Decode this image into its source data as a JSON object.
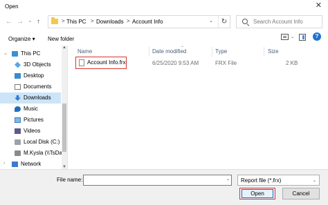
{
  "window": {
    "title": "Open",
    "close_glyph": "✕"
  },
  "nav": {
    "back_glyph": "←",
    "forward_glyph": "→",
    "dropdown_glyph": "⌄",
    "up_glyph": "↑",
    "breadcrumbs": [
      "This PC",
      "Downloads",
      "Account Info"
    ],
    "separator": ">",
    "refresh_glyph": "↻",
    "search_placeholder": "Search Account Info"
  },
  "toolbar": {
    "organize_label": "Organize ▾",
    "new_folder_label": "New folder",
    "help_glyph": "?"
  },
  "sidebar": {
    "items": [
      {
        "label": "This PC",
        "icon": "pc-icon"
      },
      {
        "label": "3D Objects",
        "icon": "3d-objects-icon"
      },
      {
        "label": "Desktop",
        "icon": "desktop-icon"
      },
      {
        "label": "Documents",
        "icon": "documents-icon"
      },
      {
        "label": "Downloads",
        "icon": "downloads-icon",
        "selected": true
      },
      {
        "label": "Music",
        "icon": "music-icon"
      },
      {
        "label": "Pictures",
        "icon": "pictures-icon"
      },
      {
        "label": "Videos",
        "icon": "videos-icon"
      },
      {
        "label": "Local Disk (C:)",
        "icon": "disk-icon"
      },
      {
        "label": "M.Kysla (\\\\TsDat",
        "icon": "network-drive-icon"
      },
      {
        "label": "Network",
        "icon": "network-icon"
      }
    ]
  },
  "columns": {
    "name": "Name",
    "date": "Date modified",
    "type": "Type",
    "size": "Size"
  },
  "files": [
    {
      "name": "Account Info.frx",
      "date": "6/25/2020 9:53 AM",
      "type": "FRX File",
      "size": "2 KB"
    }
  ],
  "footer": {
    "file_name_label": "File name:",
    "file_name_value": "",
    "file_type_value": "Report file (*.frx)",
    "open_label": "Open",
    "cancel_label": "Cancel"
  },
  "colors": {
    "highlight_box": "#d9342b",
    "selected_bg": "#cce4f7",
    "accent": "#0078d7"
  }
}
